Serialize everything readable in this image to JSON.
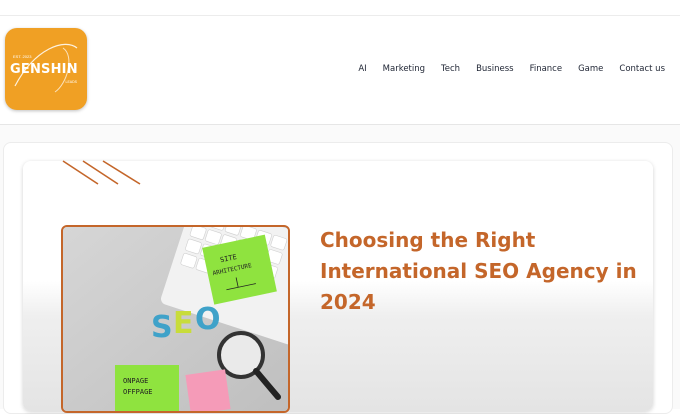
{
  "logo": {
    "est": "EST. 2023",
    "brand": "GENSHIN",
    "tagline": "LEADS",
    "color": "#f0a024"
  },
  "nav": {
    "items": [
      {
        "label": "AI"
      },
      {
        "label": "Marketing"
      },
      {
        "label": "Tech"
      },
      {
        "label": "Business"
      },
      {
        "label": "Finance"
      },
      {
        "label": "Game"
      },
      {
        "label": "Contact us"
      }
    ]
  },
  "article": {
    "title": "Choosing the Right International SEO Agency in 2024",
    "accent_color": "#c4662a",
    "image": {
      "note_text": "SITE ARCHITECTURE",
      "letters": "SEO",
      "note2_line1": "ONPAGE",
      "note2_line2": "OFFPAGE"
    }
  }
}
